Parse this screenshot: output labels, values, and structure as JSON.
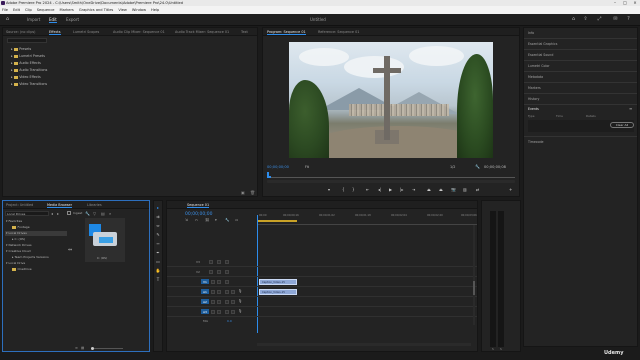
{
  "window": {
    "title": "Adobe Premiere Pro 2024 - C:\\Users\\Smith\\OneDrive\\Documents\\Adobe\\Premiere Pro\\24.0\\Untitled",
    "project_title": "Untitled"
  },
  "menu": [
    "File",
    "Edit",
    "Clip",
    "Sequence",
    "Markers",
    "Graphics and Titles",
    "View",
    "Window",
    "Help"
  ],
  "workspace_tabs": [
    {
      "label": "Import",
      "active": false
    },
    {
      "label": "Edit",
      "active": true
    },
    {
      "label": "Export",
      "active": false
    }
  ],
  "source_panel": {
    "tabs": [
      "Source: (no clips)",
      "Effects",
      "Lumetri Scopes",
      "Audio Clip Mixer: Sequence 01",
      "Audio Track Mixer: Sequence 01",
      "Text"
    ],
    "active_tab": "Effects",
    "tree": [
      "Presets",
      "Lumetri Presets",
      "Audio Effects",
      "Audio Transitions",
      "Video Effects",
      "Video Transitions"
    ]
  },
  "program_monitor": {
    "tabs": [
      "Program: Sequence 01",
      "Reference: Sequence 01"
    ],
    "current_time": "00;00;00;00",
    "fit": "Fit",
    "quality": "1/2",
    "duration": "00;00;00;08"
  },
  "project_panel": {
    "tabs": [
      "Project: Untitled",
      "Media Browser",
      "Libraries"
    ],
    "active_tab": "Media Browser",
    "location": "Local Drives",
    "ingest_label": "Ingest",
    "tree": [
      {
        "label": "Favorites",
        "indent": 0,
        "folder": false
      },
      {
        "label": "Footage",
        "indent": 1,
        "folder": true
      },
      {
        "label": "Local Drives",
        "indent": 0,
        "folder": false,
        "selected": true
      },
      {
        "label": "C: (OS)",
        "indent": 1,
        "folder": false
      },
      {
        "label": "Network Drives",
        "indent": 0,
        "folder": false
      },
      {
        "label": "Creative Cloud",
        "indent": 0,
        "folder": false
      },
      {
        "label": "Team Projects Versions",
        "indent": 1,
        "folder": false
      },
      {
        "label": "Local Drive",
        "indent": 0,
        "folder": false
      },
      {
        "label": "OneDrive",
        "indent": 1,
        "folder": true
      }
    ],
    "drive_label": "C: (OS)"
  },
  "timeline": {
    "tabs": [
      "Sequence 01"
    ],
    "current_time": "00;00;00;00",
    "ruler": [
      "00;00",
      "00;00;00;16",
      "00;00;01;02",
      "00;00;01;18",
      "00;00;02;04",
      "00;00;02;20",
      "00;00;03;06"
    ],
    "video_tracks": [
      "V3",
      "V2",
      "V1"
    ],
    "audio_tracks": [
      "A1",
      "A2",
      "A3"
    ],
    "mix_label": "Mix",
    "mix_value": "0.0",
    "clips": [
      {
        "track": "V1",
        "label": "Caption_Video-15"
      },
      {
        "track": "A1",
        "label": "Caption_Video-15"
      }
    ]
  },
  "right_panel": {
    "sections": [
      "Info",
      "Essential Graphics",
      "Essential Sound",
      "Lumetri Color",
      "Metadata",
      "Markers",
      "History"
    ],
    "events_title": "Events",
    "events_columns": [
      "Type",
      "Time",
      "Details"
    ],
    "clear_all": "Clear All",
    "bottom": "Timecode"
  },
  "branding": {
    "watermark": "Udemy"
  },
  "colors": {
    "accent": "#2d8ceb",
    "timecode": "#3a8ee6",
    "clip": "#8ea7d6"
  }
}
